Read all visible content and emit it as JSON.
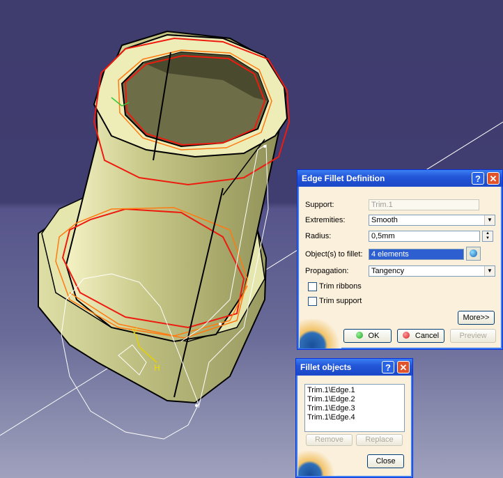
{
  "viewport": {
    "annotations": {
      "axis_v": "V",
      "axis_h": "H"
    }
  },
  "edge_fillet": {
    "title": "Edge Fillet Definition",
    "help_label": "?",
    "close_label": "✕",
    "support_label": "Support:",
    "support_value": "Trim.1",
    "extremities_label": "Extremities:",
    "extremities_value": "Smooth",
    "radius_label": "Radius:",
    "radius_value": "0,5mm",
    "objects_label": "Object(s) to fillet:",
    "objects_value": "4 elements",
    "propagation_label": "Propagation:",
    "propagation_value": "Tangency",
    "trim_ribbons_label": "Trim ribbons",
    "trim_support_label": "Trim support",
    "more_label": "More>>",
    "ok_label": "OK",
    "cancel_label": "Cancel",
    "preview_label": "Preview",
    "colors": {
      "ok": "#1aa51a",
      "cancel": "#d22020"
    }
  },
  "fillet_objects": {
    "title": "Fillet objects",
    "help_label": "?",
    "close_label": "✕",
    "items": [
      "Trim.1\\Edge.1",
      "Trim.1\\Edge.2",
      "Trim.1\\Edge.3",
      "Trim.1\\Edge.4"
    ],
    "remove_label": "Remove",
    "replace_label": "Replace",
    "close_button_label": "Close"
  }
}
